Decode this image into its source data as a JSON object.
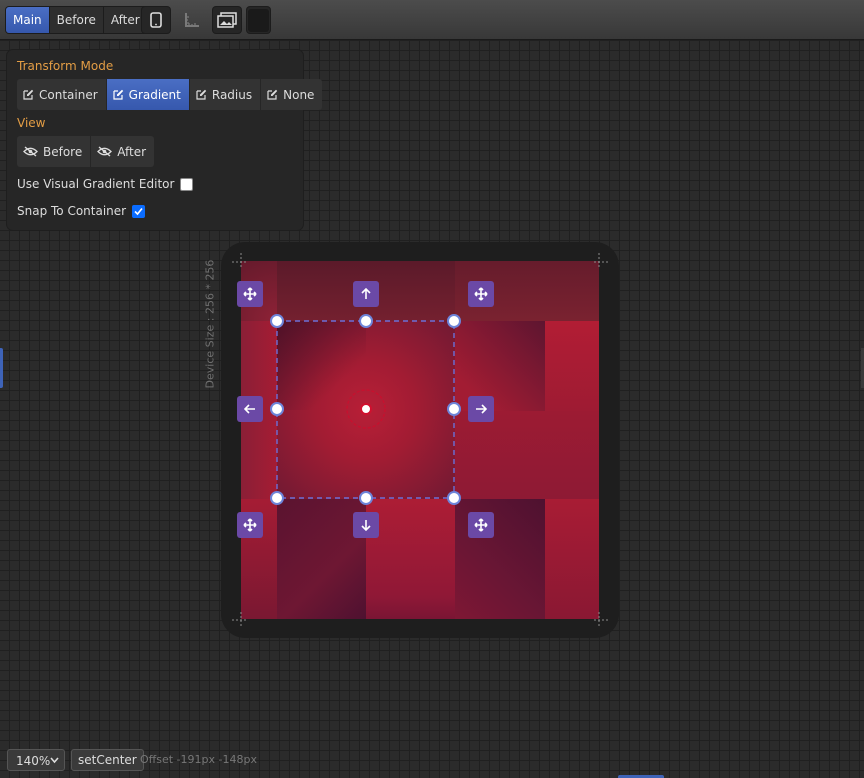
{
  "toolbar": {
    "tabs": [
      {
        "label": "Main",
        "active": true
      },
      {
        "label": "Before",
        "active": false
      },
      {
        "label": "After",
        "active": false
      }
    ],
    "icons": [
      "mobile-device-icon",
      "ruler-icon",
      "image-icon",
      "color-swatch"
    ],
    "swatch_color": "#1a1a1a"
  },
  "panel": {
    "transform_mode_title": "Transform Mode",
    "transform_modes": [
      {
        "label": "Container",
        "active": false
      },
      {
        "label": "Gradient",
        "active": true
      },
      {
        "label": "Radius",
        "active": false
      },
      {
        "label": "None",
        "active": false
      }
    ],
    "view_title": "View",
    "view_buttons": [
      {
        "label": "Before"
      },
      {
        "label": "After"
      }
    ],
    "visual_editor_label": "Use Visual Gradient Editor",
    "visual_editor_checked": false,
    "snap_label": "Snap To Container",
    "snap_checked": true
  },
  "device": {
    "size_label": "Device Size : 256 * 256"
  },
  "colors": {
    "accent": "#3e63b8",
    "handle": "#6b49a6",
    "section_title": "#e39d45",
    "gradient_center": "#b51e36",
    "gradient_edge": "#5a1030"
  },
  "bottom": {
    "zoom": "140%",
    "set_center_label": "setCenter",
    "offset_text": "Offset -191px -148px"
  }
}
